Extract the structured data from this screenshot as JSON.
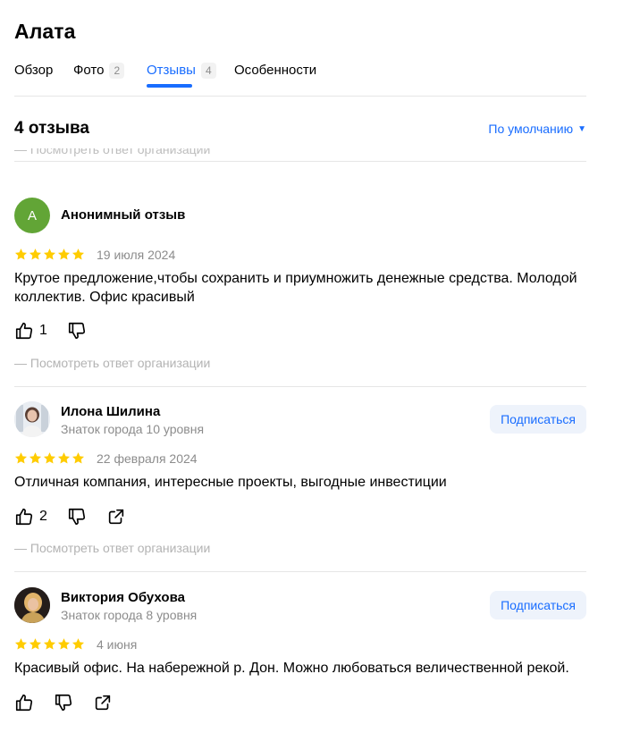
{
  "title": "Алата",
  "tabs": [
    {
      "label": "Обзор"
    },
    {
      "label": "Фото",
      "count": "2"
    },
    {
      "label": "Отзывы",
      "count": "4",
      "active": true
    },
    {
      "label": "Особенности"
    }
  ],
  "reviews_header": {
    "count_label": "4 отзыва",
    "sort_label": "По умолчанию"
  },
  "clipped_reply": "— Посмотреть ответ организации",
  "reviews": [
    {
      "avatar_letter": "А",
      "author": "Анонимный отзыв",
      "rating": 5,
      "date": "19 июля 2024",
      "text": "Крутое предложение,чтобы сохранить и приумножить денежные средства. Молодой коллектив. Офис красивый",
      "likes": "1",
      "reply_link": "— Посмотреть ответ организации"
    },
    {
      "author": "Илона Шилина",
      "level": "Знаток города 10 уровня",
      "subscribe": "Подписаться",
      "rating": 5,
      "date": "22 февраля 2024",
      "text": "Отличная компания, интересные проекты, выгодные инвестиции",
      "likes": "2",
      "reply_link": "— Посмотреть ответ организации"
    },
    {
      "author": "Виктория Обухова",
      "level": "Знаток города 8 уровня",
      "subscribe": "Подписаться",
      "rating": 5,
      "date": "4 июня",
      "text": "Красивый офис. На набережной р. Дон. Можно любоваться величественной рекой."
    }
  ],
  "colors": {
    "accent": "#196dff",
    "star": "#fc0",
    "avatar_green": "#62a536"
  }
}
